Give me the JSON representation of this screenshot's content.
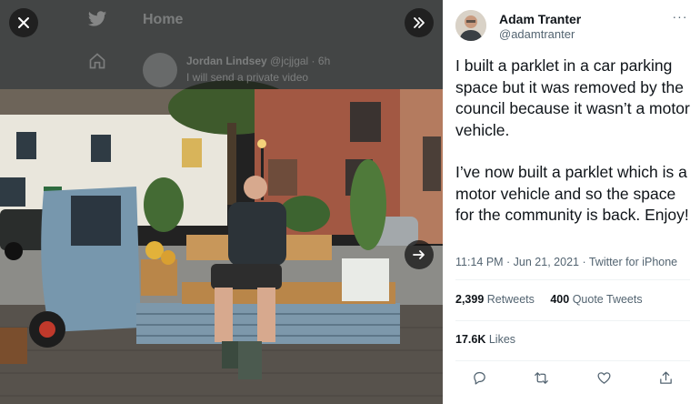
{
  "background_page": {
    "title": "Home",
    "post_author": "Jordan Lindsey",
    "post_handle": "@jcjjgal · 6h",
    "post_snippet": "I will send a private video"
  },
  "media_viewer": {
    "close_icon": "close-icon",
    "expand_icon": "chevrons-right-icon",
    "next_icon": "arrow-right-icon"
  },
  "tweet": {
    "author_name": "Adam Tranter",
    "author_handle": "@adamtranter",
    "more_label": "···",
    "text_p1": "I built a parklet in a car parking space but it was removed by the council because it wasn’t a motor vehicle.",
    "text_p2": "I’ve now built a parklet which is a motor vehicle and so the space for the community is back. Enjoy!",
    "timestamp": "11:14 PM · Jun 21, 2021",
    "separator": " · ",
    "client": "Twitter for iPhone",
    "retweets_count": "2,399",
    "retweets_label": "Retweets",
    "quotes_count": "400",
    "quotes_label": "Quote Tweets",
    "likes_count": "17.6K",
    "likes_label": "Likes"
  },
  "actions": [
    "reply-icon",
    "retweet-icon",
    "like-icon",
    "share-icon"
  ],
  "colors": {
    "text_primary": "#0f1419",
    "text_secondary": "#536471",
    "divider": "#eff3f4"
  }
}
